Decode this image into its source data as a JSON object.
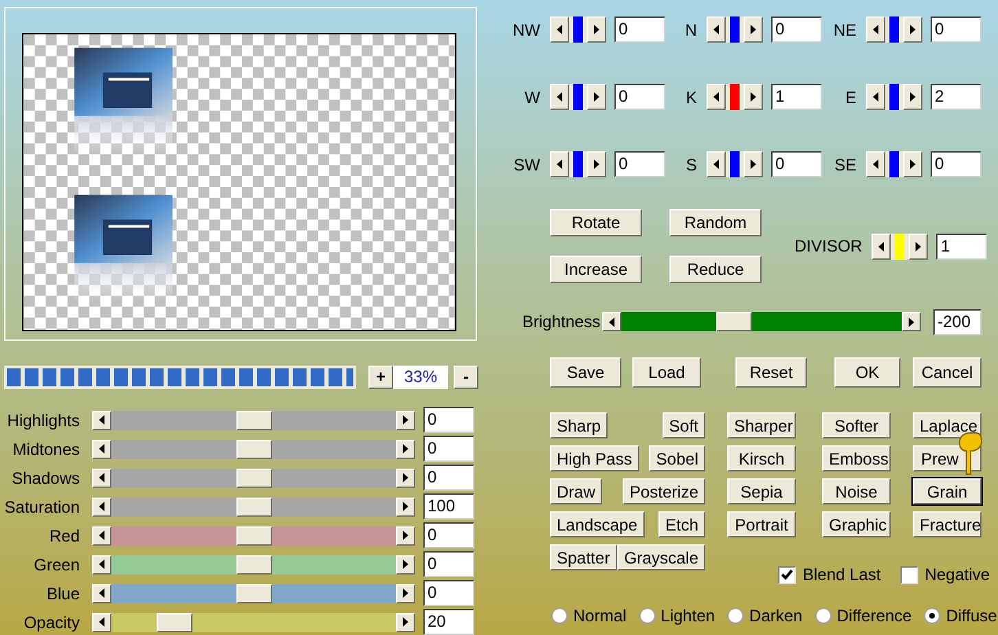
{
  "progress": {
    "level": 1
  },
  "zoom": {
    "plus": "+",
    "value": "33%",
    "minus": "-"
  },
  "adjustments": [
    {
      "label": "Highlights",
      "level": 0.5,
      "color": "#a6a6a6",
      "value": "0"
    },
    {
      "label": "Midtones",
      "level": 0.5,
      "color": "#a6a6a6",
      "value": "0"
    },
    {
      "label": "Shadows",
      "level": 0.5,
      "color": "#a6a6a6",
      "value": "0"
    },
    {
      "label": "Saturation",
      "level": 0.5,
      "color": "#a6a6a6",
      "value": "100"
    },
    {
      "label": "Red",
      "level": 0.5,
      "color": "#c89496",
      "value": "0"
    },
    {
      "label": "Green",
      "level": 0.5,
      "color": "#94c894",
      "value": "0"
    },
    {
      "label": "Blue",
      "level": 0.5,
      "color": "#7ea7c8",
      "value": "0"
    },
    {
      "label": "Opacity",
      "level": 0.22,
      "color": "#c8c864",
      "value": "20"
    }
  ],
  "kernel": [
    {
      "label": "NW",
      "color": "#0000ff",
      "level": 0.5,
      "value": "0"
    },
    {
      "label": "N",
      "color": "#0000ff",
      "level": 0.5,
      "value": "0"
    },
    {
      "label": "NE",
      "color": "#0000ff",
      "level": 0.5,
      "value": "0"
    },
    {
      "label": "W",
      "color": "#0000ff",
      "level": 0.5,
      "value": "0"
    },
    {
      "label": "K",
      "color": "#ff0000",
      "level": 0.5,
      "value": "1"
    },
    {
      "label": "E",
      "color": "#0000ff",
      "level": 0.5,
      "value": "2"
    },
    {
      "label": "SW",
      "color": "#0000ff",
      "level": 0.5,
      "value": "0"
    },
    {
      "label": "S",
      "color": "#0000ff",
      "level": 0.5,
      "value": "0"
    },
    {
      "label": "SE",
      "color": "#0000ff",
      "level": 0.5,
      "value": "0"
    }
  ],
  "matrix_buttons": [
    [
      "Rotate",
      "Random"
    ],
    [
      "Increase",
      "Reduce"
    ]
  ],
  "divisor": {
    "label": "DIVISOR",
    "color": "#ffff00",
    "level": 0.5,
    "value": "1"
  },
  "brightness": {
    "label": "Brightness",
    "color": "#008000",
    "level": 0.4,
    "value": "-200"
  },
  "action_buttons": [
    "Save",
    "Load",
    "Reset",
    "OK",
    "Cancel"
  ],
  "filter_buttons": [
    [
      {
        "label": "Sharp",
        "focused": false
      },
      {
        "label": "Soft",
        "focused": false
      },
      {
        "label": "Sharper",
        "focused": false
      },
      {
        "label": "Softer",
        "focused": false
      },
      {
        "label": "Laplace",
        "focused": false
      }
    ],
    [
      {
        "label": "High Pass",
        "focused": false
      },
      {
        "label": "Sobel",
        "focused": false
      },
      {
        "label": "Kirsch",
        "focused": false
      },
      {
        "label": "Emboss",
        "focused": false
      },
      {
        "label": "Prew",
        "focused": false
      }
    ],
    [
      {
        "label": "Draw",
        "focused": false
      },
      {
        "label": "Posterize",
        "focused": false
      },
      {
        "label": "Sepia",
        "focused": false
      },
      {
        "label": "Noise",
        "focused": false
      },
      {
        "label": "Grain",
        "focused": true
      }
    ],
    [
      {
        "label": "Landscape",
        "focused": false
      },
      {
        "label": "Etch",
        "focused": false
      },
      {
        "label": "Portrait",
        "focused": false
      },
      {
        "label": "Graphic",
        "focused": false
      },
      {
        "label": "Fracture",
        "focused": false
      }
    ],
    [
      {
        "label": "Spatter",
        "focused": false
      },
      {
        "label": "Grayscale",
        "focused": false
      }
    ]
  ],
  "checkboxes": [
    {
      "label": "Blend Last",
      "checked": true
    },
    {
      "label": "Negative",
      "checked": false
    }
  ],
  "blend_modes": [
    {
      "label": "Normal",
      "selected": false
    },
    {
      "label": "Lighten",
      "selected": false
    },
    {
      "label": "Darken",
      "selected": false
    },
    {
      "label": "Difference",
      "selected": false
    },
    {
      "label": "Diffuse",
      "selected": true
    }
  ]
}
